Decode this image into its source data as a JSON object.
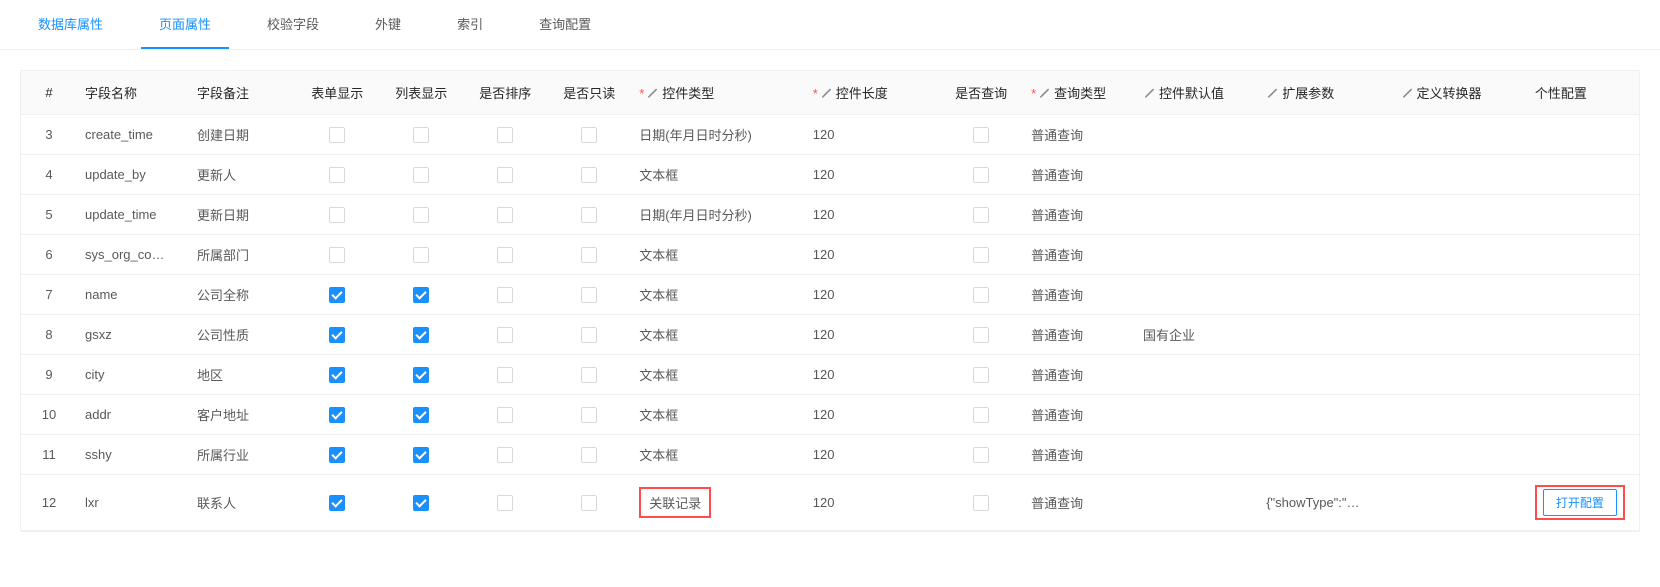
{
  "tabs": {
    "db": "数据库属性",
    "page": "页面属性",
    "check": "校验字段",
    "fk": "外键",
    "index": "索引",
    "query": "查询配置"
  },
  "headers": {
    "idx": "#",
    "field_name": "字段名称",
    "field_remark": "字段备注",
    "form_show": "表单显示",
    "list_show": "列表显示",
    "sortable": "是否排序",
    "readonly": "是否只读",
    "ctrl_type": "控件类型",
    "ctrl_len": "控件长度",
    "queryable": "是否查询",
    "query_type": "查询类型",
    "ctrl_default": "控件默认值",
    "ext_params": "扩展参数",
    "converter": "定义转换器",
    "custom_cfg": "个性配置"
  },
  "rows": [
    {
      "idx": "3",
      "name": "create_time",
      "remark": "创建日期",
      "form": false,
      "list": false,
      "sort": false,
      "ro": false,
      "ctype": "日期(年月日时分秒)",
      "clen": "120",
      "q": false,
      "qtype": "普通查询",
      "def": "",
      "ext": "",
      "conv": "",
      "cfg": "",
      "hl_ctype": false,
      "hl_cfg": false
    },
    {
      "idx": "4",
      "name": "update_by",
      "remark": "更新人",
      "form": false,
      "list": false,
      "sort": false,
      "ro": false,
      "ctype": "文本框",
      "clen": "120",
      "q": false,
      "qtype": "普通查询",
      "def": "",
      "ext": "",
      "conv": "",
      "cfg": "",
      "hl_ctype": false,
      "hl_cfg": false
    },
    {
      "idx": "5",
      "name": "update_time",
      "remark": "更新日期",
      "form": false,
      "list": false,
      "sort": false,
      "ro": false,
      "ctype": "日期(年月日时分秒)",
      "clen": "120",
      "q": false,
      "qtype": "普通查询",
      "def": "",
      "ext": "",
      "conv": "",
      "cfg": "",
      "hl_ctype": false,
      "hl_cfg": false
    },
    {
      "idx": "6",
      "name": "sys_org_co…",
      "remark": "所属部门",
      "form": false,
      "list": false,
      "sort": false,
      "ro": false,
      "ctype": "文本框",
      "clen": "120",
      "q": false,
      "qtype": "普通查询",
      "def": "",
      "ext": "",
      "conv": "",
      "cfg": "",
      "hl_ctype": false,
      "hl_cfg": false
    },
    {
      "idx": "7",
      "name": "name",
      "remark": "公司全称",
      "form": true,
      "list": true,
      "sort": false,
      "ro": false,
      "ctype": "文本框",
      "clen": "120",
      "q": false,
      "qtype": "普通查询",
      "def": "",
      "ext": "",
      "conv": "",
      "cfg": "",
      "hl_ctype": false,
      "hl_cfg": false
    },
    {
      "idx": "8",
      "name": "gsxz",
      "remark": "公司性质",
      "form": true,
      "list": true,
      "sort": false,
      "ro": false,
      "ctype": "文本框",
      "clen": "120",
      "q": false,
      "qtype": "普通查询",
      "def": "国有企业",
      "ext": "",
      "conv": "",
      "cfg": "",
      "hl_ctype": false,
      "hl_cfg": false
    },
    {
      "idx": "9",
      "name": "city",
      "remark": "地区",
      "form": true,
      "list": true,
      "sort": false,
      "ro": false,
      "ctype": "文本框",
      "clen": "120",
      "q": false,
      "qtype": "普通查询",
      "def": "",
      "ext": "",
      "conv": "",
      "cfg": "",
      "hl_ctype": false,
      "hl_cfg": false
    },
    {
      "idx": "10",
      "name": "addr",
      "remark": "客户地址",
      "form": true,
      "list": true,
      "sort": false,
      "ro": false,
      "ctype": "文本框",
      "clen": "120",
      "q": false,
      "qtype": "普通查询",
      "def": "",
      "ext": "",
      "conv": "",
      "cfg": "",
      "hl_ctype": false,
      "hl_cfg": false
    },
    {
      "idx": "11",
      "name": "sshy",
      "remark": "所属行业",
      "form": true,
      "list": true,
      "sort": false,
      "ro": false,
      "ctype": "文本框",
      "clen": "120",
      "q": false,
      "qtype": "普通查询",
      "def": "",
      "ext": "",
      "conv": "",
      "cfg": "",
      "hl_ctype": false,
      "hl_cfg": false
    },
    {
      "idx": "12",
      "name": "lxr",
      "remark": "联系人",
      "form": true,
      "list": true,
      "sort": false,
      "ro": false,
      "ctype": "关联记录",
      "clen": "120",
      "q": false,
      "qtype": "普通查询",
      "def": "",
      "ext": "{\"showType\":\"…",
      "conv": "",
      "cfg": "打开配置",
      "hl_ctype": true,
      "hl_cfg": true
    }
  ],
  "required_marker": "*"
}
